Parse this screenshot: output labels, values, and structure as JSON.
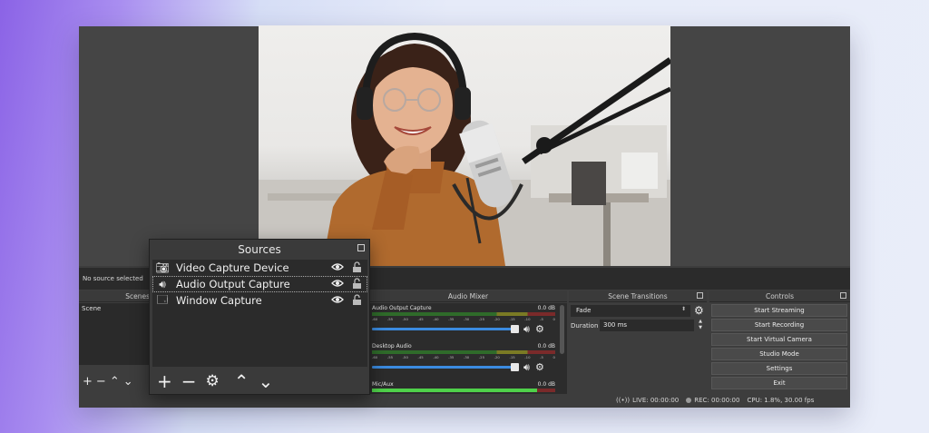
{
  "main": {
    "no_source_label": "No source selected",
    "preview_image": "woman-with-headphones-and-studio-microphone"
  },
  "scenes": {
    "title": "Scenes",
    "items": [
      "Scene"
    ]
  },
  "sources": {
    "title": "Sources",
    "items": [
      {
        "label": "Video Capture Device",
        "icon": "camera-icon"
      },
      {
        "label": "Audio Output Capture",
        "icon": "speaker-icon"
      },
      {
        "label": "Window Capture",
        "icon": "window-icon"
      }
    ]
  },
  "mixer": {
    "title": "Audio Mixer",
    "channels": [
      {
        "name": "Audio Output Capture",
        "db": "0.0 dB",
        "level": 0.0,
        "volume": 1.0
      },
      {
        "name": "Desktop Audio",
        "db": "0.0 dB",
        "level": 0.0,
        "volume": 1.0
      },
      {
        "name": "Mic/Aux",
        "db": "0.0 dB",
        "level": 0.9,
        "volume": 1.0
      }
    ],
    "ticks": [
      "-60",
      "-55",
      "-50",
      "-45",
      "-40",
      "-35",
      "-30",
      "-25",
      "-20",
      "-15",
      "-10",
      "-5",
      "0"
    ]
  },
  "transitions": {
    "title": "Scene Transitions",
    "selected": "Fade",
    "duration_label": "Duration",
    "duration_value": "300 ms"
  },
  "controls": {
    "title": "Controls",
    "buttons": [
      "Start Streaming",
      "Start Recording",
      "Start Virtual Camera",
      "Studio Mode",
      "Settings",
      "Exit"
    ]
  },
  "status": {
    "live": "LIVE: 00:00:00",
    "rec": "REC: 00:00:00",
    "cpu": "CPU: 1.8%, 30.00 fps"
  },
  "colors": {
    "panel": "#3d3d3d",
    "dark": "#2b2b2b",
    "volume_blue": "#3b8be0",
    "meter_green": "#4fd14a"
  }
}
